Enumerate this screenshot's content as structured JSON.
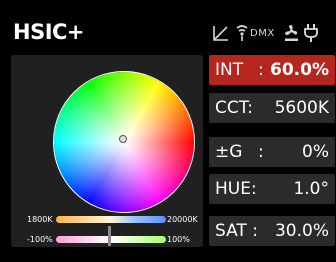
{
  "header": {
    "title": "HSIC+",
    "dmx_label": "DMX"
  },
  "sliders": {
    "cct": {
      "min_label": "1800K",
      "max_label": "20000K",
      "position": 0.5
    },
    "tint": {
      "min_label": "-100%",
      "max_label": "100%",
      "position": 0.5
    }
  },
  "params": [
    {
      "label": "INT",
      "sep": ":",
      "value": "60.0%",
      "active": true
    },
    {
      "label": "CCT:",
      "sep": "",
      "value": "5600K",
      "active": false
    },
    {
      "label": "±G",
      "sep": ":",
      "value": "0%",
      "active": false
    },
    {
      "label": "HUE:",
      "sep": "",
      "value": "1.0°",
      "active": false
    },
    {
      "label": "SAT :",
      "sep": "",
      "value": "30.0%",
      "active": false
    }
  ],
  "colors": {
    "active": "#b5261e",
    "tile": "#2b2b2b",
    "panel": "#202020",
    "status_icon": "#d9d9d9"
  }
}
